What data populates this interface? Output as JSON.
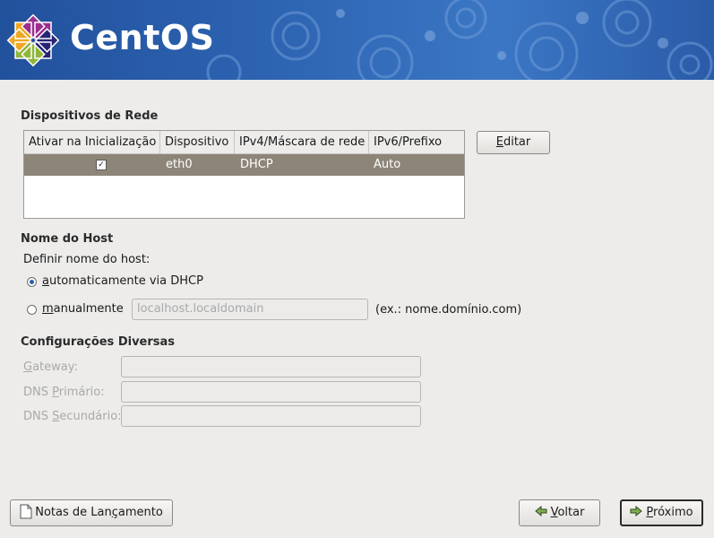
{
  "header": {
    "logo_text": "CentOS",
    "colors": {
      "banner": "#2c62b0",
      "logo_yellow": "#efa724",
      "logo_green": "#8fb53a",
      "logo_purple": "#9c2e8f",
      "logo_blue": "#262577"
    }
  },
  "network": {
    "title": "Dispositivos de Rede",
    "columns": [
      "Ativar na Inicialização",
      "Dispositivo",
      "IPv4/Máscara de rede",
      "IPv6/Prefixo"
    ],
    "rows": [
      {
        "enabled": true,
        "device": "eth0",
        "ipv4": "DHCP",
        "ipv6": "Auto"
      }
    ],
    "edit_button": {
      "label_u": "E",
      "label_rest": "ditar"
    }
  },
  "hostname": {
    "title": "Nome do Host",
    "prompt": "Definir nome do host:",
    "auto_option": {
      "u": "a",
      "rest": "utomaticamente via DHCP",
      "selected": true
    },
    "manual_option": {
      "u": "m",
      "rest": "anualmente",
      "selected": false
    },
    "manual_placeholder": "localhost.localdomain",
    "example": "(ex.: nome.domínio.com)"
  },
  "misc": {
    "title": "Configurações Diversas",
    "gateway": {
      "label_u": "G",
      "label_rest": "ateway:",
      "value": ""
    },
    "dns1": {
      "label_pre": "DNS ",
      "label_u": "P",
      "label_rest": "rimário:",
      "value": ""
    },
    "dns2": {
      "label_pre": "DNS ",
      "label_u": "S",
      "label_rest": "ecundário:",
      "value": ""
    }
  },
  "footer": {
    "release_notes": {
      "label_pre": "Notas de Lan",
      "label_u": "ç",
      "label_rest": "amento",
      "icon": "document-icon"
    },
    "back": {
      "label_u": "V",
      "label_rest": "oltar",
      "icon": "arrow-left-icon"
    },
    "next": {
      "label_u": "P",
      "label_rest": "róximo",
      "icon": "arrow-right-icon"
    }
  }
}
